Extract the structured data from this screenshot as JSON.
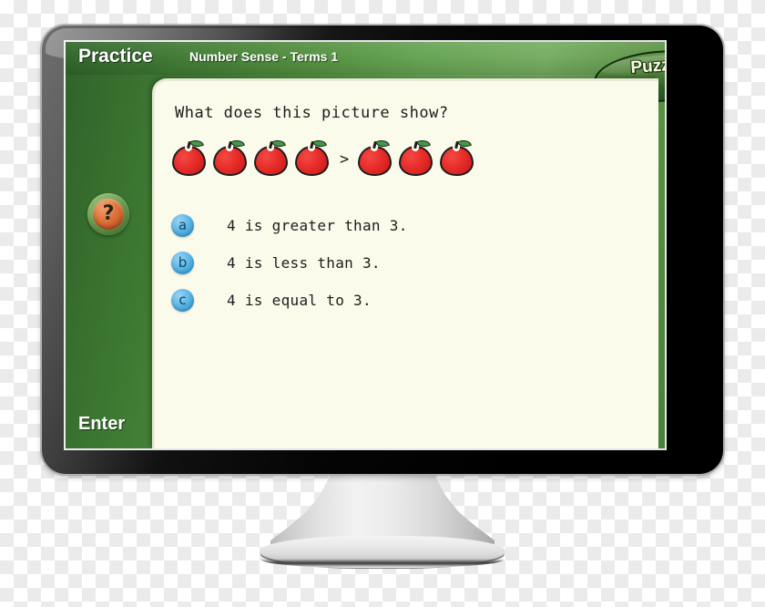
{
  "app": {
    "mode_label": "Practice",
    "lesson_title": "Number Sense - Terms 1",
    "tab_label": "Puzzle",
    "enter_label": "Enter",
    "help_icon_glyph": "?",
    "help_icon_name": "question-mark-icon"
  },
  "question": {
    "prompt": "What does this picture show?",
    "picture": {
      "left_count": 4,
      "right_count": 3,
      "item": "apple",
      "comparison_symbol": ">"
    },
    "options": [
      {
        "key": "a",
        "text": "4 is greater than 3."
      },
      {
        "key": "b",
        "text": "4 is less than 3."
      },
      {
        "key": "c",
        "text": "4 is equal to 3."
      }
    ]
  },
  "colors": {
    "screen_green_dark": "#2f6329",
    "screen_green_light": "#74ac61",
    "panel_cream": "#fbfbec",
    "apple_red": "#ea2e2a",
    "leaf_green": "#3f9c42",
    "badge_blue": "#3d9fd6",
    "help_orange": "#e2793f",
    "bezel_black": "#000000"
  }
}
